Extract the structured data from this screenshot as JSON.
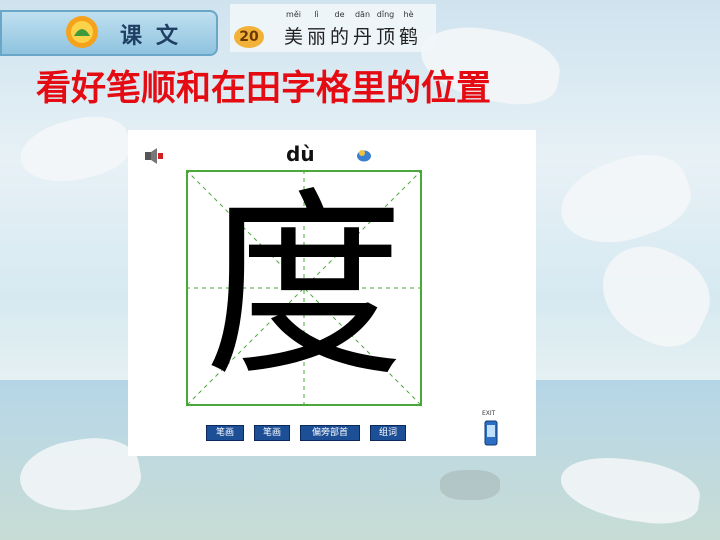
{
  "header": {
    "badge_label": "课文",
    "lesson_number": "20",
    "title_pinyin": [
      "měi",
      "lì",
      "de",
      "dān",
      "dǐng",
      "hè"
    ],
    "title_chars": [
      "美",
      "丽",
      "的",
      "丹",
      "顶",
      "鹤"
    ]
  },
  "instruction": "看好笔顺和在田字格里的位置",
  "panel": {
    "pinyin": "dù",
    "character": "度",
    "buttons": [
      "笔画",
      "笔画",
      "偏旁部首",
      "组词"
    ],
    "exit_label": "EXIT"
  },
  "colors": {
    "instruction": "#e40c12",
    "grid_border": "#4aa83a",
    "button": "#1d4f97"
  }
}
